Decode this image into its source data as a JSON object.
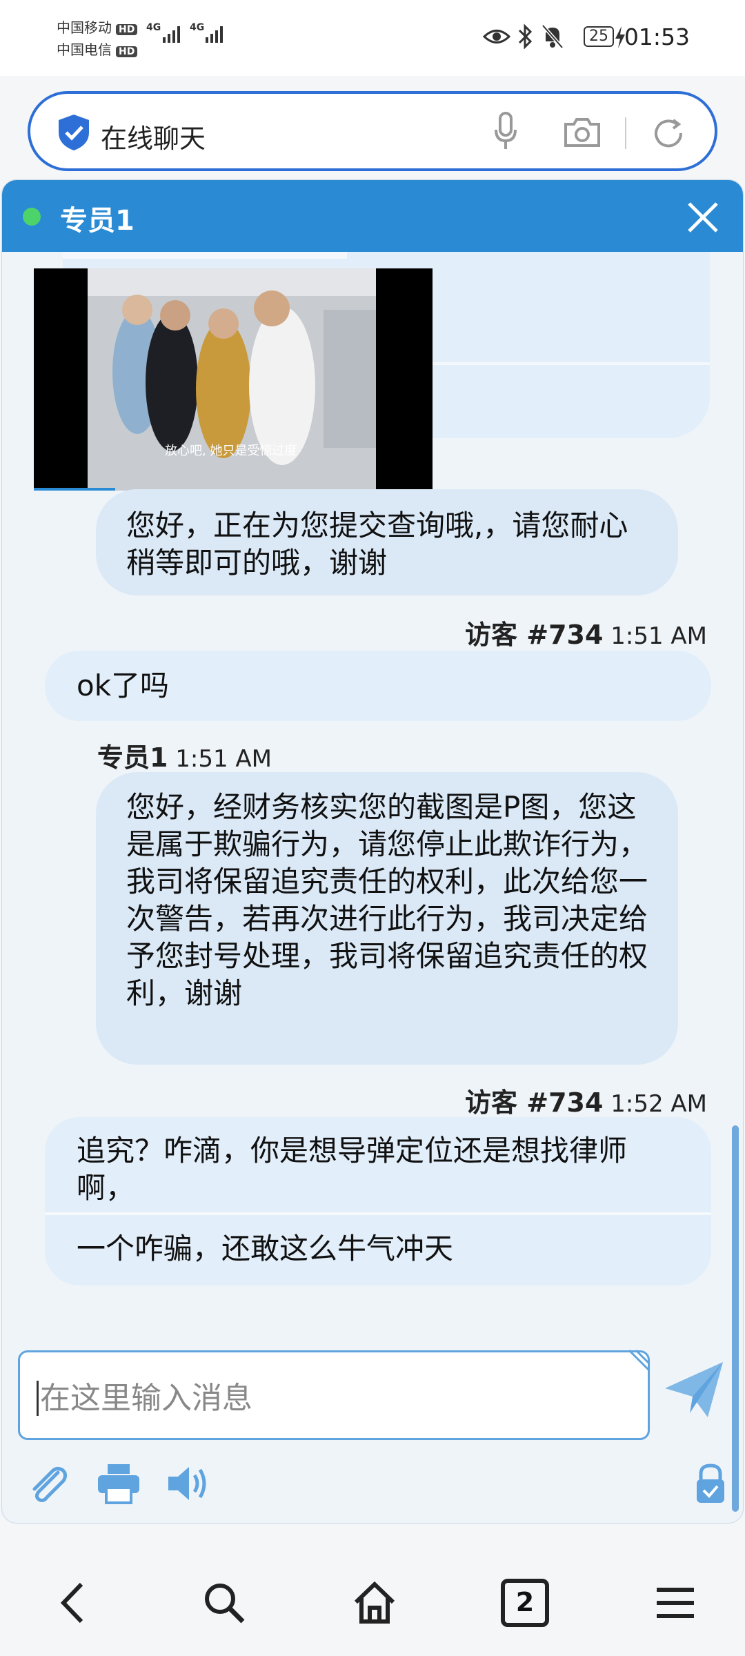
{
  "status_bar": {
    "carrier1": "中国移动",
    "carrier2": "中国电信",
    "hd": "HD",
    "net": "4G",
    "battery": "25",
    "time": "01:53"
  },
  "search": {
    "text": "在线聊天"
  },
  "chat": {
    "header_title": "专员1",
    "agent_msg_1": "您好，正在为您提交查询哦,，请您耐心稍等即可的哦，谢谢",
    "visitor_name_1": "访客 #734",
    "visitor_time_1": "1:51 AM",
    "visitor_msg_1": "ok了吗",
    "agent_name_2": "专员1",
    "agent_time_2": "1:51 AM",
    "agent_msg_2": "您好，经财务核实您的截图是P图，您这是属于欺骗行为，请您停止此欺诈行为，我司将保留追究责任的权利，此次给您一次警告，若再次进行此行为，我司决定给予您封号处理，我司将保留追究责任的权利，谢谢",
    "visitor_name_2": "访客 #734",
    "visitor_time_2": "1:52 AM",
    "visitor_msg_2a": "追究？咋滴，你是想导弹定位还是想找律师啊，",
    "visitor_msg_2b": "一个咋骗，还敢这么牛气冲天",
    "video_subtitle": "放心吧, 她只是受惊过度"
  },
  "input": {
    "placeholder": "在这里输入消息"
  },
  "nav": {
    "tabs_count": "2"
  },
  "colors": {
    "header": "#2a8ad4",
    "agent_bubble": "#dbe9f7",
    "visitor_bubble": "#e2eef9",
    "accent": "#5fa3df"
  }
}
